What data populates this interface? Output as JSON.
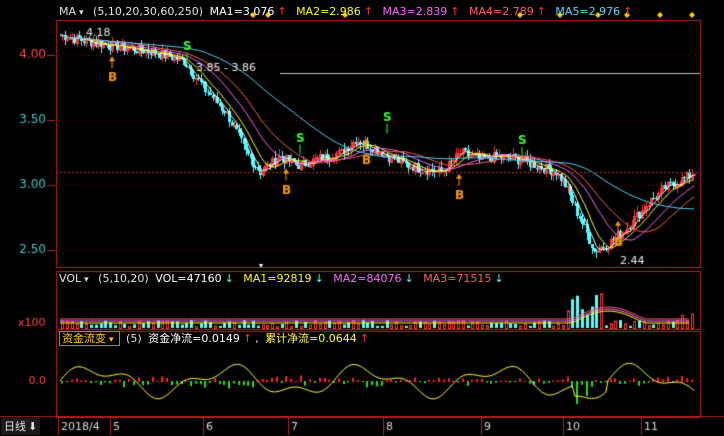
{
  "colors": {
    "bg": "#000000",
    "grid": "#7a0f0f",
    "axis": "#b52020",
    "up": "#ff3232",
    "down": "#54ffff",
    "ma1": "#ffffff",
    "ma2": "#ffff00",
    "ma3": "#ff66ff",
    "ma4": "#ff6060",
    "ma5": "#4fd8ff",
    "price_red": "#ff4a4a",
    "price_teal": "#3fc6c6",
    "signal_b": "#ff9900",
    "signal_s": "#33ff33",
    "diamond": "#ffd700",
    "flow_pos": "#ff2020",
    "flow_neg": "#22dd22",
    "flow_line": "#ffff30"
  },
  "main_legend": {
    "name": "MA",
    "dropdown": "▾",
    "params": "(5,10,20,30,60,250)",
    "ma1": "MA1=3.076",
    "ma1_arrow": "↑",
    "ma2": "MA2=2.986",
    "ma2_arrow": "↑",
    "ma3": "MA3=2.839",
    "ma3_arrow": "↑",
    "ma4": "MA4=2.789",
    "ma4_arrow": "↑",
    "ma5": "MA5=2.976",
    "ma5_arrow": "↑"
  },
  "vol_legend": {
    "name": "VOL",
    "dropdown": "▾",
    "params": "(5,10,20)",
    "vol": "VOL=47160",
    "vol_arrow": "↓",
    "ma1": "MA1=92819",
    "ma1_arrow": "↓",
    "ma2": "MA2=84076",
    "ma2_arrow": "↓",
    "ma3": "MA3=71515",
    "ma3_arrow": "↓"
  },
  "flow_legend": {
    "name": "资金流变",
    "dropdown": "▾",
    "params": "(5)",
    "net": "资金净流=0.0149",
    "net_arrow": "↑",
    "cum": "累计净流=0.0644",
    "cum_arrow": "↑"
  },
  "axis": {
    "price_ticks": [
      "4.00",
      "3.50",
      "3.00",
      "2.50"
    ],
    "vol_unit": "x100",
    "flow_tick": "0.0",
    "months": [
      "2018/4",
      "5",
      "6",
      "7",
      "8",
      "9",
      "10",
      "11"
    ]
  },
  "annotations": {
    "high": "4.18",
    "range": "3.85 - 3.86",
    "low": "2.44",
    "buy": "B",
    "sell": "S"
  },
  "bottom_tab": {
    "label": "日线",
    "arrow": "⬇"
  }
}
